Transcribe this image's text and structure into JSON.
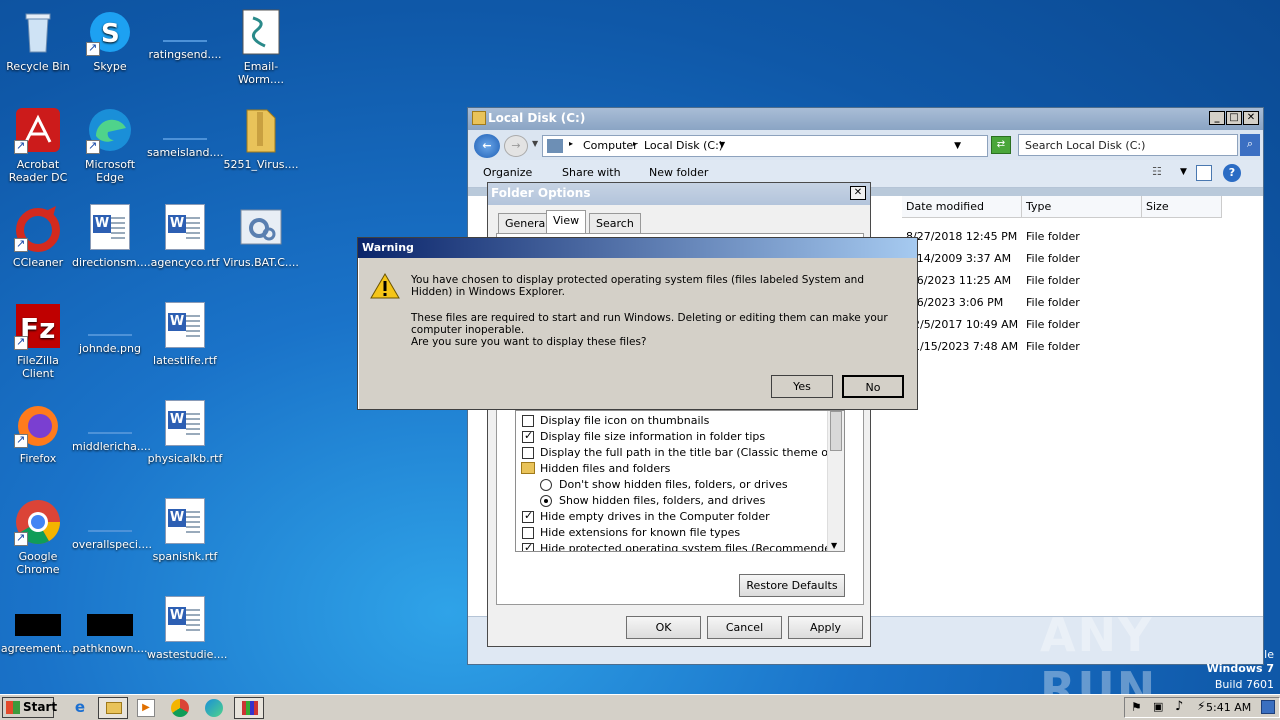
{
  "desktop": {
    "icons": [
      {
        "label": "Recycle Bin"
      },
      {
        "label": "Skype"
      },
      {
        "label": "ratingsend...."
      },
      {
        "label": "Email-Worm...."
      },
      {
        "label": "Acrobat Reader DC"
      },
      {
        "label": "Microsoft Edge"
      },
      {
        "label": "sameisland...."
      },
      {
        "label": "5251_Virus...."
      },
      {
        "label": "CCleaner"
      },
      {
        "label": "directionsm...."
      },
      {
        "label": "agencyco.rtf"
      },
      {
        "label": "Virus.BAT.C...."
      },
      {
        "label": "FileZilla Client"
      },
      {
        "label": "johnde.png"
      },
      {
        "label": "latestlife.rtf"
      },
      {
        "label": "Firefox"
      },
      {
        "label": "middlericha...."
      },
      {
        "label": "physicalkb.rtf"
      },
      {
        "label": "Google Chrome"
      },
      {
        "label": "overallspeci...."
      },
      {
        "label": "spanishk.rtf"
      },
      {
        "label": "agreement...."
      },
      {
        "label": "pathknown...."
      },
      {
        "label": "wastestudie...."
      }
    ]
  },
  "explorer": {
    "title": "Local Disk (C:)",
    "breadcrumb": [
      "Computer",
      "Local Disk (C:)"
    ],
    "search_placeholder": "Search Local Disk (C:)",
    "toolbar": {
      "organize": "Organize",
      "share": "Share with",
      "new_folder": "New folder"
    },
    "columns": [
      "Date modified",
      "Type",
      "Size"
    ],
    "rows": [
      {
        "date": "8/27/2018 12:45 PM",
        "type": "File folder"
      },
      {
        "date": "7/14/2009 3:37 AM",
        "type": "File folder"
      },
      {
        "date": "2/6/2023 11:25 AM",
        "type": "File folder"
      },
      {
        "date": "2/6/2023 3:06 PM",
        "type": "File folder"
      },
      {
        "date": "12/5/2017 10:49 AM",
        "type": "File folder"
      },
      {
        "date": "11/15/2023 7:48 AM",
        "type": "File folder"
      }
    ]
  },
  "folder_options": {
    "title": "Folder Options",
    "tabs": [
      "General",
      "View",
      "Search"
    ],
    "active_tab": "View",
    "advanced_items": [
      {
        "label": "Display file icon on thumbnails",
        "kind": "checkbox",
        "checked": false
      },
      {
        "label": "Display file size information in folder tips",
        "kind": "checkbox",
        "checked": true
      },
      {
        "label": "Display the full path in the title bar (Classic theme only)",
        "kind": "checkbox",
        "checked": false
      },
      {
        "label": "Hidden files and folders",
        "kind": "folder",
        "checked": false
      },
      {
        "label": "Don't show hidden files, folders, or drives",
        "kind": "radio",
        "checked": false
      },
      {
        "label": "Show hidden files, folders, and drives",
        "kind": "radio",
        "checked": true
      },
      {
        "label": "Hide empty drives in the Computer folder",
        "kind": "checkbox",
        "checked": true
      },
      {
        "label": "Hide extensions for known file types",
        "kind": "checkbox",
        "checked": false
      },
      {
        "label": "Hide protected operating system files (Recommended)",
        "kind": "checkbox",
        "checked": true
      }
    ],
    "restore_defaults": "Restore Defaults",
    "ok": "OK",
    "cancel": "Cancel",
    "apply": "Apply"
  },
  "warning": {
    "title": "Warning",
    "line1": "You have chosen to display protected operating system files (files labeled System and Hidden) in Windows Explorer.",
    "line2": "These files are required to start and run Windows. Deleting or editing them can make your computer inoperable.",
    "line3": "Are you sure you want to display these files?",
    "yes": "Yes",
    "no": "No"
  },
  "taskbar": {
    "start": "Start",
    "clock": "5:41 AM"
  },
  "os": {
    "partial_text": "le",
    "edition": "Windows 7",
    "build": "Build 7601"
  },
  "watermark": "ANY RUN"
}
